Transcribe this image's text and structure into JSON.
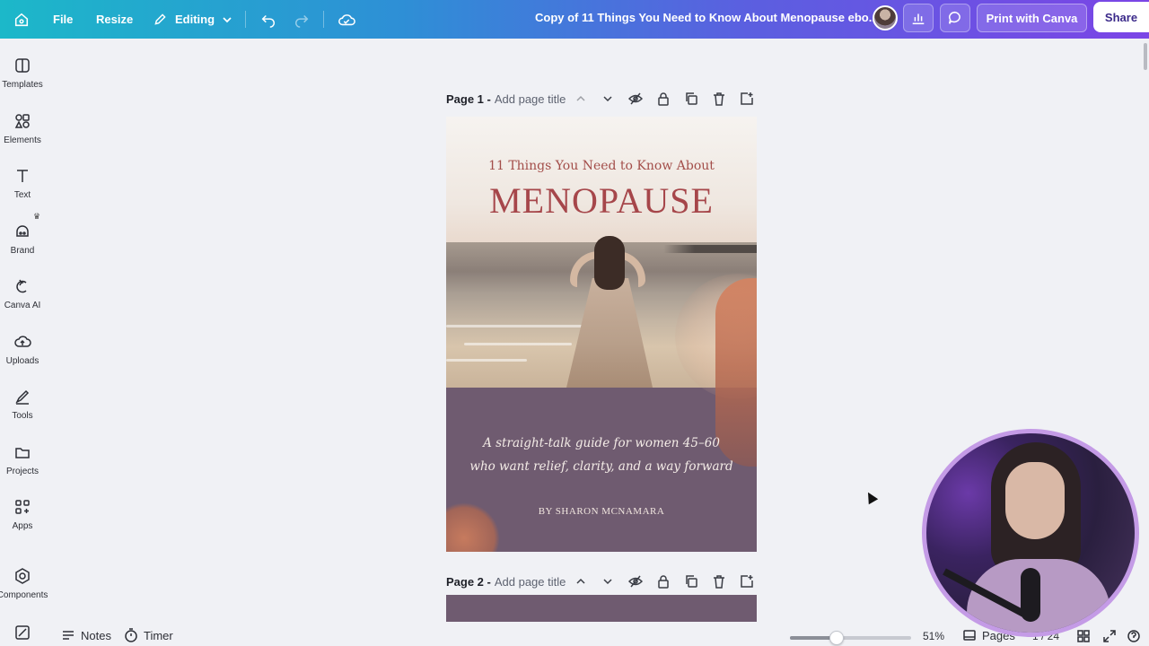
{
  "topbar": {
    "file_label": "File",
    "resize_label": "Resize",
    "editing_label": "Editing",
    "doc_title": "Copy of 11 Things You Need to Know About Menopause ebo...",
    "print_label": "Print with Canva",
    "share_label": "Share",
    "colors": {
      "gradient_start": "#1cb8c9",
      "gradient_end": "#7b45e6"
    }
  },
  "sidebar": {
    "items": [
      {
        "label": "Templates",
        "icon": "templates-icon"
      },
      {
        "label": "Elements",
        "icon": "elements-icon"
      },
      {
        "label": "Text",
        "icon": "text-icon"
      },
      {
        "label": "Brand",
        "icon": "brand-icon"
      },
      {
        "label": "Canva AI",
        "icon": "canva-ai-icon"
      },
      {
        "label": "Uploads",
        "icon": "uploads-icon"
      },
      {
        "label": "Tools",
        "icon": "tools-icon"
      },
      {
        "label": "Projects",
        "icon": "projects-icon"
      },
      {
        "label": "Apps",
        "icon": "apps-icon"
      },
      {
        "label": "Components",
        "icon": "components-icon"
      }
    ]
  },
  "pages": [
    {
      "page_label": "Page 1 -",
      "title_placeholder": "Add page title"
    },
    {
      "page_label": "Page 2 -",
      "title_placeholder": "Add page title"
    }
  ],
  "page1_content": {
    "top_line": "11 Things You Need to Know About",
    "main_title": "MENOPAUSE",
    "subtitle_line1": "A straight-talk guide for women 45–60",
    "subtitle_line2": "who want relief, clarity, and a way forward",
    "author": "BY SHARON MCNAMARA",
    "colors": {
      "title": "#a6464a",
      "panel": "#6f5b70"
    }
  },
  "footer": {
    "notes_label": "Notes",
    "timer_label": "Timer",
    "zoom_value": "51%",
    "zoom_fraction": 0.51,
    "pages_label": "Pages",
    "page_count": "1 / 24"
  }
}
